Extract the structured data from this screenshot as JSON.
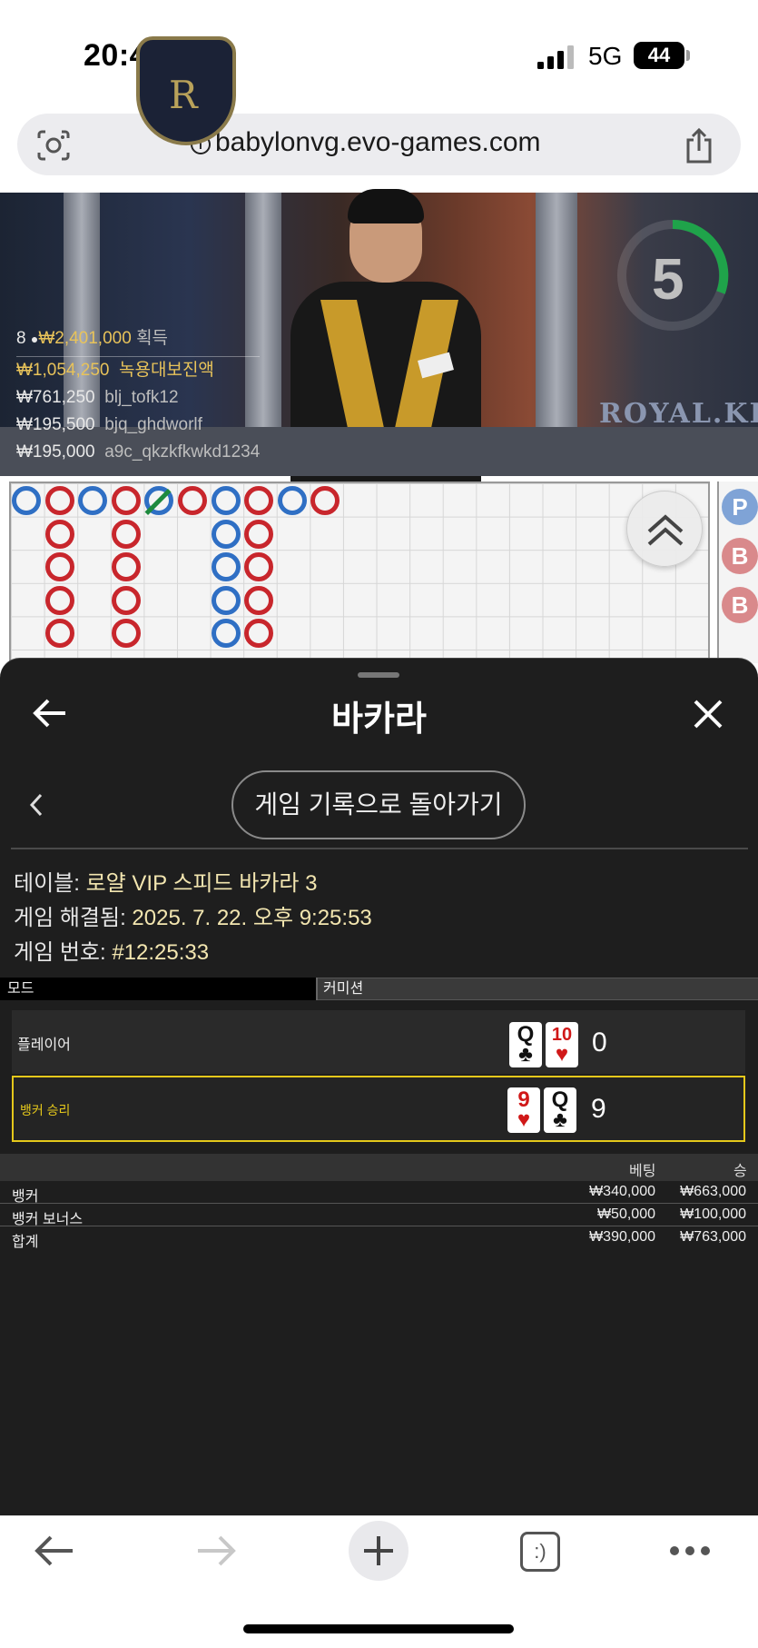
{
  "status_bar": {
    "time": "20:43",
    "network": "5G",
    "battery": "44"
  },
  "url_bar": {
    "url": "babylonvg.evo-games.com"
  },
  "video": {
    "timer": "5",
    "watermark": "ROYAL.KR",
    "winners": {
      "count": "8",
      "total": "₩2,401,000",
      "total_suffix": "획득",
      "rows": [
        {
          "amount": "₩1,054,250",
          "name": "녹용대보진액"
        },
        {
          "amount": "₩761,250",
          "name": "blj_tofk12"
        },
        {
          "amount": "₩195,500",
          "name": "bjq_ghdworlf"
        },
        {
          "amount": "₩195,000",
          "name": "a9c_qkzkfkwkd1234"
        }
      ]
    }
  },
  "roadmap": {
    "side_labels": [
      "P",
      "B",
      "B"
    ],
    "colors": {
      "banker": "#c8262c",
      "player": "#2f6fc4",
      "tie": "#1e8a3e"
    }
  },
  "sheet": {
    "title": "바카라",
    "back_to_history": "게임 기록으로 돌아가기",
    "table_label": "테이블:",
    "table_value": "로얄 VIP 스피드 바카라 3",
    "resolved_label": "게임 해결됨:",
    "resolved_value": "2025. 7. 22. 오후 9:25:53",
    "game_no_label": "게임 번호:",
    "game_no_value": "#12:25:33",
    "mode_label": "모드",
    "mode_value": "커미션",
    "player": {
      "label": "플레이어",
      "cards": [
        {
          "rank": "Q",
          "suit": "♣",
          "color": "black"
        },
        {
          "rank": "10",
          "suit": "♥",
          "color": "red"
        }
      ],
      "score": "0"
    },
    "banker": {
      "label": "뱅커 승리",
      "cards": [
        {
          "rank": "9",
          "suit": "♥",
          "color": "red"
        },
        {
          "rank": "Q",
          "suit": "♣",
          "color": "black"
        }
      ],
      "score": "9"
    },
    "bets": {
      "header_bet": "베팅",
      "header_win": "승",
      "rows": [
        {
          "name": "뱅커",
          "bet": "₩340,000",
          "win": "₩663,000"
        },
        {
          "name": "뱅커 보너스",
          "bet": "₩50,000",
          "win": "₩100,000"
        },
        {
          "name": "합계",
          "bet": "₩390,000",
          "win": "₩763,000"
        }
      ]
    }
  },
  "browser_bar": {
    "icons": [
      "back-arrow-icon",
      "forward-arrow-icon",
      "new-tab-plus-icon",
      "tabs-icon",
      "more-icon"
    ],
    "tabs_label": ":)"
  }
}
